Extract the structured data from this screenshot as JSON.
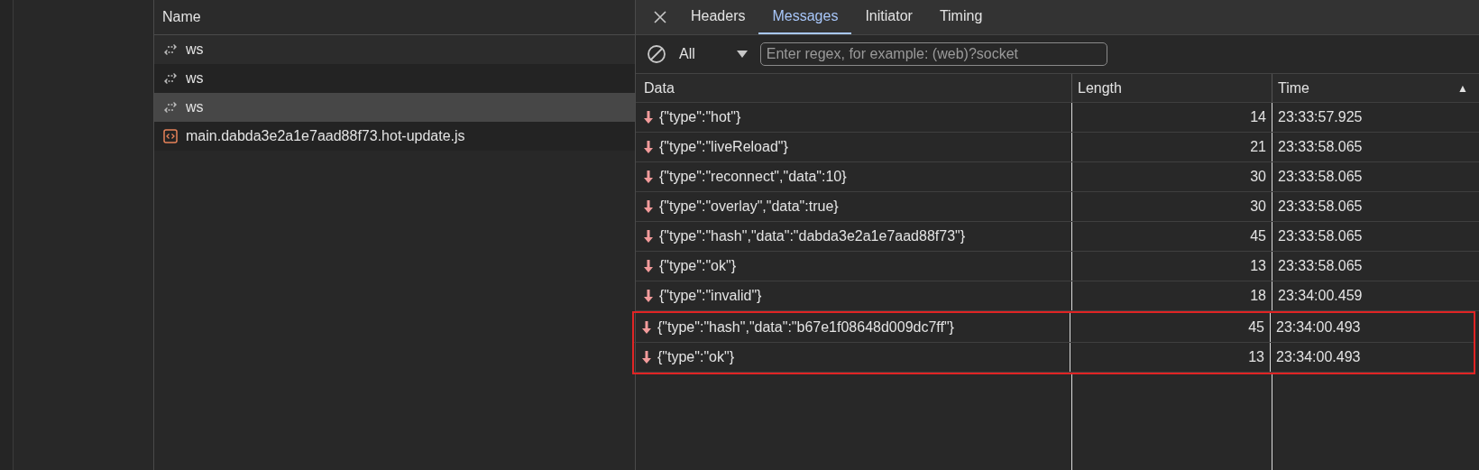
{
  "requests": {
    "header": "Name",
    "items": [
      {
        "name": "ws",
        "kind": "websocket",
        "selected": false
      },
      {
        "name": "ws",
        "kind": "websocket",
        "selected": false
      },
      {
        "name": "ws",
        "kind": "websocket",
        "selected": true
      },
      {
        "name": "main.dabda3e2a1e7aad88f73.hot-update.js",
        "kind": "script",
        "selected": false
      }
    ]
  },
  "tabs": [
    {
      "label": "Headers",
      "selected": false
    },
    {
      "label": "Messages",
      "selected": true
    },
    {
      "label": "Initiator",
      "selected": false
    },
    {
      "label": "Timing",
      "selected": false
    }
  ],
  "filter": {
    "type": "All",
    "placeholder": "Enter regex, for example: (web)?socket"
  },
  "table": {
    "columns": [
      "Data",
      "Length",
      "Time"
    ],
    "sort_indicator": "▲",
    "rows": [
      {
        "data": "{\"type\":\"hot\"}",
        "length": "14",
        "time": "23:33:57.925",
        "highlighted": false
      },
      {
        "data": "{\"type\":\"liveReload\"}",
        "length": "21",
        "time": "23:33:58.065",
        "highlighted": false
      },
      {
        "data": "{\"type\":\"reconnect\",\"data\":10}",
        "length": "30",
        "time": "23:33:58.065",
        "highlighted": false
      },
      {
        "data": "{\"type\":\"overlay\",\"data\":true}",
        "length": "30",
        "time": "23:33:58.065",
        "highlighted": false
      },
      {
        "data": "{\"type\":\"hash\",\"data\":\"dabda3e2a1e7aad88f73\"}",
        "length": "45",
        "time": "23:33:58.065",
        "highlighted": false
      },
      {
        "data": "{\"type\":\"ok\"}",
        "length": "13",
        "time": "23:33:58.065",
        "highlighted": false
      },
      {
        "data": "{\"type\":\"invalid\"}",
        "length": "18",
        "time": "23:34:00.459",
        "highlighted": false
      },
      {
        "data": "{\"type\":\"hash\",\"data\":\"b67e1f08648d009dc7ff\"}",
        "length": "45",
        "time": "23:34:00.493",
        "highlighted": true
      },
      {
        "data": "{\"type\":\"ok\"}",
        "length": "13",
        "time": "23:34:00.493",
        "highlighted": true
      }
    ]
  }
}
